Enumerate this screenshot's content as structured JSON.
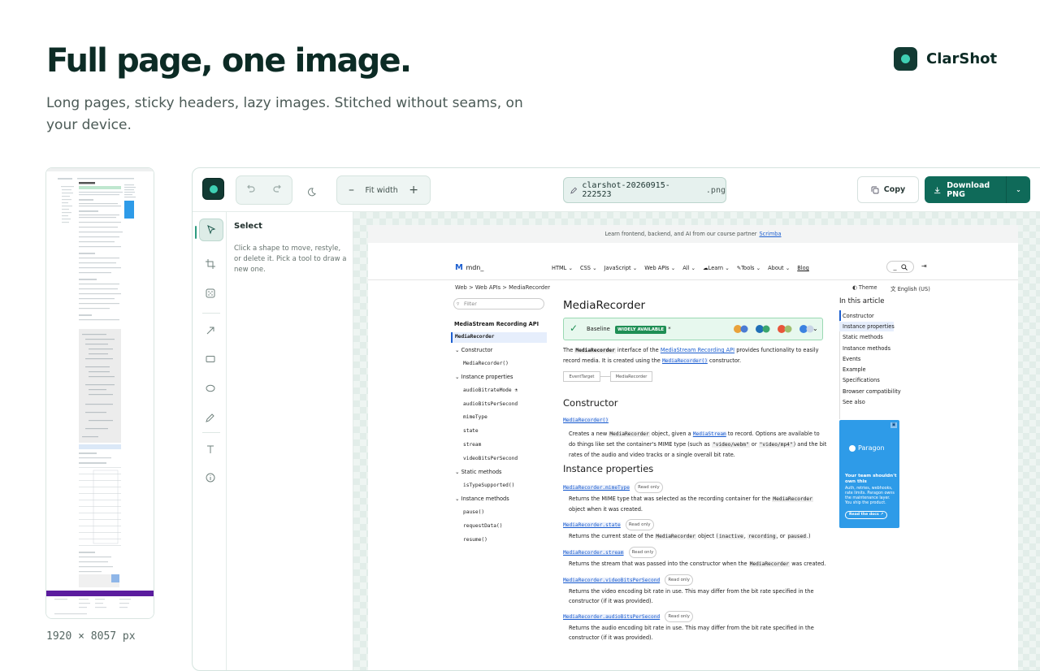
{
  "hero": {
    "title": "Full page, one image.",
    "subtitle": "Long pages, sticky headers, lazy images. Stitched without seams, on your device."
  },
  "brand": {
    "name": "ClarShot"
  },
  "preview": {
    "dimensions": "1920 × 8057 px"
  },
  "toolbar": {
    "zoom_label": "Fit width",
    "filename": "clarshot-20260915-222523",
    "extension": ".png",
    "copy_label": "Copy",
    "download_label": "Download PNG"
  },
  "tools": [
    "select",
    "crop",
    "blur",
    "arrow",
    "rectangle",
    "ellipse",
    "pen",
    "text",
    "info"
  ],
  "side_panel": {
    "title": "Select",
    "description": "Click a shape to move, restyle, or delete it. Pick a tool to draw a new one."
  },
  "mdn": {
    "banner_text": "Learn frontend, backend, and AI from our course partner",
    "banner_link": "Scrimba",
    "logo": "mdn_",
    "nav": [
      "HTML",
      "CSS",
      "JavaScript",
      "Web APIs",
      "All",
      "Learn",
      "Tools",
      "About",
      "Blog"
    ],
    "search_mark": "_",
    "breadcrumbs": [
      "Web",
      "Web APIs",
      "MediaRecorder"
    ],
    "theme": "Theme",
    "language": "English (US)",
    "filter_placeholder": "Filter",
    "sidebar": {
      "heading": "MediaStream Recording API",
      "items": [
        {
          "label": "MediaRecorder",
          "kind": "current"
        },
        {
          "label": "Constructor",
          "kind": "group"
        },
        {
          "label": "MediaRecorder()",
          "kind": "code"
        },
        {
          "label": "Instance properties",
          "kind": "group"
        },
        {
          "label": "audioBitrateMode",
          "kind": "code"
        },
        {
          "label": "audioBitsPerSecond",
          "kind": "code"
        },
        {
          "label": "mimeType",
          "kind": "code"
        },
        {
          "label": "state",
          "kind": "code"
        },
        {
          "label": "stream",
          "kind": "code"
        },
        {
          "label": "videoBitsPerSecond",
          "kind": "code"
        },
        {
          "label": "Static methods",
          "kind": "group"
        },
        {
          "label": "isTypeSupported()",
          "kind": "code"
        },
        {
          "label": "Instance methods",
          "kind": "group"
        },
        {
          "label": "pause()",
          "kind": "code"
        },
        {
          "label": "requestData()",
          "kind": "code"
        },
        {
          "label": "resume()",
          "kind": "code"
        }
      ]
    },
    "article": {
      "title": "MediaRecorder",
      "baseline_label": "Baseline",
      "baseline_badge": "WIDELY AVAILABLE",
      "baseline_mark": "*",
      "intro_prefix": "The",
      "intro_code": "MediaRecorder",
      "intro_mid": "interface of the",
      "intro_link": "MediaStream Recording API",
      "intro_after": "provides functionality to easily record media. It is created using the",
      "intro_code2": "MediaRecorder()",
      "intro_end": "constructor.",
      "inherit": [
        "EventTarget",
        "MediaRecorder"
      ],
      "constructor_heading": "Constructor",
      "ctor_name": "MediaRecorder()",
      "ctor_desc1": "Creates a new",
      "ctor_code1": "MediaRecorder",
      "ctor_desc2": "object, given a",
      "ctor_link": "MediaStream",
      "ctor_desc3": "to record. Options are available to do things like set the container's MIME type (such as",
      "ctor_code2": "\"video/webm\"",
      "ctor_or": "or",
      "ctor_code3": "\"video/mp4\"",
      "ctor_desc4": ") and the bit rates of the audio and video tracks or a single overall bit rate.",
      "props_heading": "Instance properties",
      "read_only": "Read only",
      "props": [
        {
          "name": "MediaRecorder.mimeType",
          "d1": "Returns the MIME type that was selected as the recording container for the",
          "c1": "MediaRecorder",
          "d2": "object when it was created."
        },
        {
          "name": "MediaRecorder.state",
          "d1": "Returns the current state of the",
          "c1": "MediaRecorder",
          "d2": "object (",
          "c2": "inactive",
          "d3": ",",
          "c3": "recording",
          "d4": ", or",
          "c4": "paused",
          "d5": ".)"
        },
        {
          "name": "MediaRecorder.stream",
          "d1": "Returns the stream that was passed into the constructor when the",
          "c1": "MediaRecorder",
          "d2": "was created."
        },
        {
          "name": "MediaRecorder.videoBitsPerSecond",
          "d1": "Returns the video encoding bit rate in use. This may differ from the bit rate specified in the constructor (if it was provided)."
        },
        {
          "name": "MediaRecorder.audioBitsPerSecond",
          "d1": "Returns the audio encoding bit rate in use. This may differ from the bit rate specified in the constructor (if it was provided)."
        }
      ]
    },
    "toc": {
      "heading": "In this article",
      "items": [
        "Constructor",
        "Instance properties",
        "Static methods",
        "Instance methods",
        "Events",
        "Example",
        "Specifications",
        "Browser compatibility",
        "See also"
      ]
    },
    "ad": {
      "brand": "Paragon",
      "headline": "Your team shouldn't own this",
      "body": "Auth, retries, webhooks, rate limits. Paragon owns the maintenance layer. You ship the product.",
      "cta": "Read the docs"
    }
  },
  "colors": {
    "brand_dark": "#123a33",
    "accent": "#0f6a59",
    "mint": "#3fd0b4",
    "link": "#1d5fd0"
  }
}
